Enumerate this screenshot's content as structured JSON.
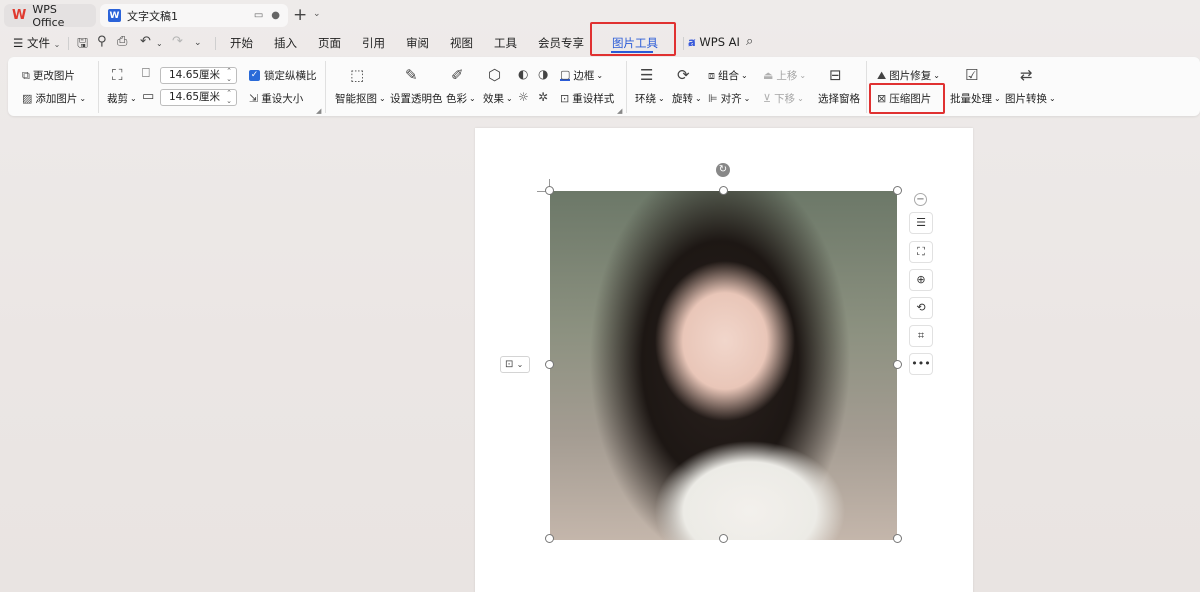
{
  "titlebar": {
    "app_tab": "WPS Office",
    "doc_tab": "文字文稿1",
    "new_tab": "+",
    "new_tab_menu": "⌄"
  },
  "menubar": {
    "file": "文件",
    "tabs": [
      "开始",
      "插入",
      "页面",
      "引用",
      "审阅",
      "视图",
      "工具",
      "会员专享"
    ],
    "active_tab": "图片工具",
    "wps_ai": "WPS AI"
  },
  "ribbon": {
    "change_picture": "更改图片",
    "add_picture": "添加图片",
    "crop": "裁剪",
    "width_value": "14.65厘米",
    "height_value": "14.65厘米",
    "lock_ratio": "锁定纵横比",
    "reset_size": "重设大小",
    "smart_cutout": "智能抠图",
    "set_transparent": "设置透明色",
    "color": "色彩",
    "effects": "效果",
    "border": "边框",
    "reset_style": "重设样式",
    "wrap": "环绕",
    "rotate": "旋转",
    "group": "组合",
    "align": "对齐",
    "bring_forward": "上移",
    "send_backward": "下移",
    "selection_pane": "选择窗格",
    "picture_repair": "图片修复",
    "compress_picture": "压缩图片",
    "batch_process": "批量处理",
    "picture_convert": "图片转换"
  },
  "colors": {
    "accent": "#2a5bd7",
    "highlight_border": "#e03131",
    "wps_red": "#e03a2f"
  }
}
